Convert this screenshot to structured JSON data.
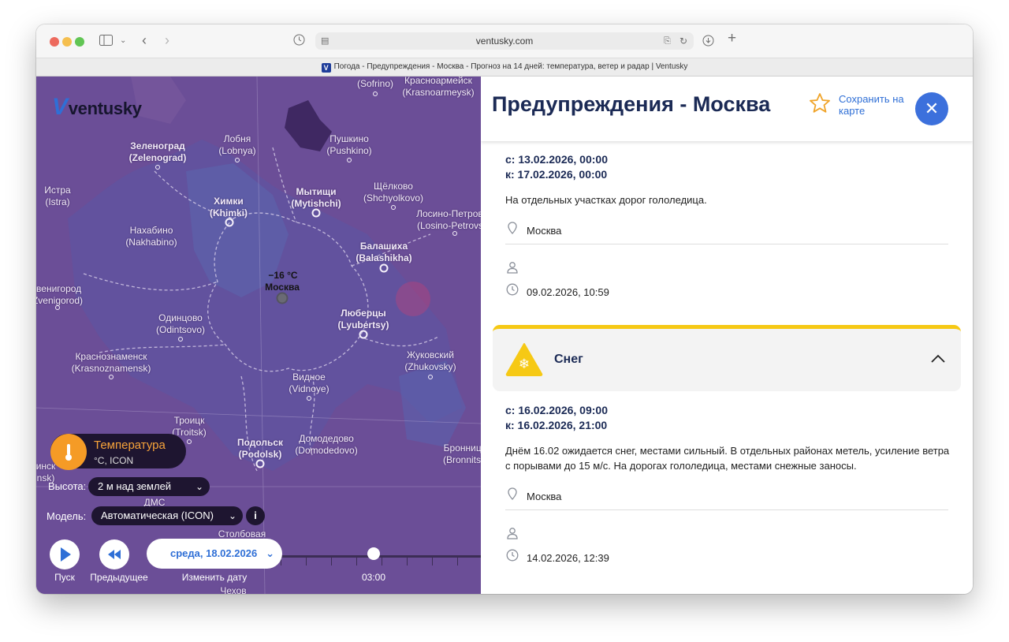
{
  "browser": {
    "url": "ventusky.com",
    "tab_title": "Погода - Предупреждения - Москва - Прогноз на 14 дней: температура, ветер и радар | Ventusky",
    "favicon": "V"
  },
  "map": {
    "logo": "ventusky",
    "center_marker": {
      "temp": "−16 °C",
      "name": "Москва"
    },
    "cities": [
      {
        "id": "sofrino",
        "lines": [
          "(Sofrino)"
        ],
        "bold": false
      },
      {
        "id": "krasnoarmeysk",
        "lines": [
          "Красноармейск",
          "(Krasnoarmeysk)"
        ],
        "bold": false
      },
      {
        "id": "zelenograd",
        "lines": [
          "Зеленоград",
          "(Zelenograd)"
        ],
        "bold": true
      },
      {
        "id": "lobnya",
        "lines": [
          "Лобня",
          "(Lobnya)"
        ],
        "bold": false
      },
      {
        "id": "pushkino",
        "lines": [
          "Пушкино",
          "(Pushkino)"
        ],
        "bold": false
      },
      {
        "id": "istra",
        "lines": [
          "Истра",
          "(Istra)"
        ],
        "bold": false
      },
      {
        "id": "khimki",
        "lines": [
          "Химки",
          "(Khimki)"
        ],
        "bold": true
      },
      {
        "id": "mytishchi",
        "lines": [
          "Мытищи",
          "(Mytishchi)"
        ],
        "bold": true
      },
      {
        "id": "shchyolkovo",
        "lines": [
          "Щёлково",
          "(Shchyolkovo)"
        ],
        "bold": false
      },
      {
        "id": "losino",
        "lines": [
          "Лосино-Петровск",
          "(Losino-Petrovsk)"
        ],
        "bold": false
      },
      {
        "id": "nakhabino",
        "lines": [
          "Нахабино",
          "(Nakhabino)"
        ],
        "bold": false
      },
      {
        "id": "balashikha",
        "lines": [
          "Балашиха",
          "(Balashikha)"
        ],
        "bold": true
      },
      {
        "id": "zvenigorod",
        "lines": [
          "Звенигород",
          "(Zvenigorod)"
        ],
        "bold": false
      },
      {
        "id": "odintsovo",
        "lines": [
          "Одинцово",
          "(Odintsovo)"
        ],
        "bold": false
      },
      {
        "id": "lyubertsy",
        "lines": [
          "Люберцы",
          "(Lyubertsy)"
        ],
        "bold": true
      },
      {
        "id": "krasnoznamensk",
        "lines": [
          "Краснознаменск",
          "(Krasnoznamensk)"
        ],
        "bold": false
      },
      {
        "id": "zhukovsky",
        "lines": [
          "Жуковский",
          "(Zhukovsky)"
        ],
        "bold": false
      },
      {
        "id": "vidnoye",
        "lines": [
          "Видное",
          "(Vidnoye)"
        ],
        "bold": false
      },
      {
        "id": "troitsk",
        "lines": [
          "Троицк",
          "(Troitsk)"
        ],
        "bold": false
      },
      {
        "id": "podolsk",
        "lines": [
          "Подольск",
          "(Podolsk)"
        ],
        "bold": true
      },
      {
        "id": "domodedovo",
        "lines": [
          "Домодедово",
          "(Domodedovo)"
        ],
        "bold": false
      },
      {
        "id": "bronnitsy",
        "lines": [
          "Бронницы",
          "(Bronnitsy)"
        ],
        "bold": false
      },
      {
        "id": "stolbovaya",
        "lines": [
          "Столбовая"
        ],
        "bold": false
      },
      {
        "id": "chekhov",
        "lines": [
          "Чехов"
        ],
        "bold": false
      },
      {
        "id": "dms",
        "lines": [
          "ДМС"
        ],
        "bold": false
      },
      {
        "id": "nsk",
        "lines": [
          "инск",
          "nsk)"
        ],
        "bold": false
      }
    ],
    "layer": {
      "name": "Температура",
      "sub": "°C, ICON"
    },
    "height": {
      "label": "Высота:",
      "value": "2 м над землей"
    },
    "model": {
      "label": "Модель:",
      "value": "Автоматическая (ICON)"
    },
    "timeline": {
      "date": "среда, 18.02.2026",
      "time": "03:00",
      "play_label": "Пуск",
      "prev_label": "Предыдущее",
      "change_date_label": "Изменить дату"
    }
  },
  "panel": {
    "title": "Предупреждения - Москва",
    "save_label": "Сохранить на карте",
    "close_symbol": "✕",
    "warning1": {
      "from": "с: 13.02.2026, 00:00",
      "to": "к: 17.02.2026, 00:00",
      "text": "На отдельных участках дорог гололедица.",
      "location": "Москва",
      "issued": "09.02.2026, 10:59"
    },
    "warning2": {
      "type": "Снег",
      "accent_color": "#f6c915",
      "from": "с: 16.02.2026, 09:00",
      "to": "к: 16.02.2026, 21:00",
      "text": "Днём 16.02 ожидается снег, местами сильный. В отдельных районах метель, усиление ветра с порывами до 15 м/с. На дорогах гололедица, местами снежные заносы.",
      "location": "Москва",
      "issued": "14.02.2026, 12:39"
    }
  }
}
